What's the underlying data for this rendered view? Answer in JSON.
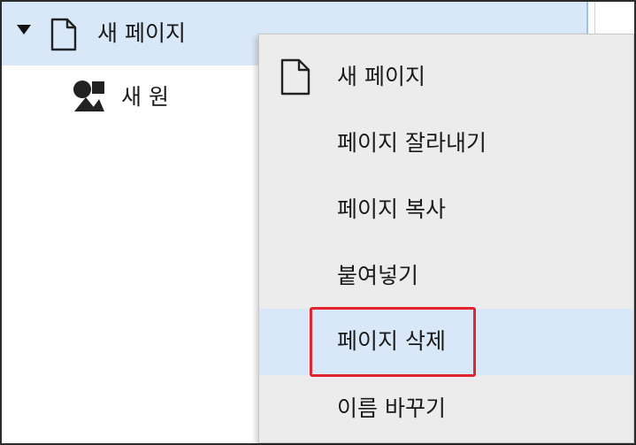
{
  "tree": {
    "page_node": {
      "label": "새 페이지",
      "icon": "page-icon",
      "expanded": true
    },
    "shape_node": {
      "label": "새 원",
      "icon": "shapes-icon"
    }
  },
  "context_menu": {
    "items": [
      {
        "label": "새 페이지",
        "icon": "page-icon"
      },
      {
        "label": "페이지 잘라내기"
      },
      {
        "label": "페이지 복사"
      },
      {
        "label": "붙여넣기"
      },
      {
        "label": "페이지 삭제",
        "selected": true
      },
      {
        "label": "이름 바꾸기"
      }
    ]
  },
  "colors": {
    "selection": "#d9e8f8",
    "menu_background": "#ececec",
    "highlight_box": "#e3232d"
  }
}
